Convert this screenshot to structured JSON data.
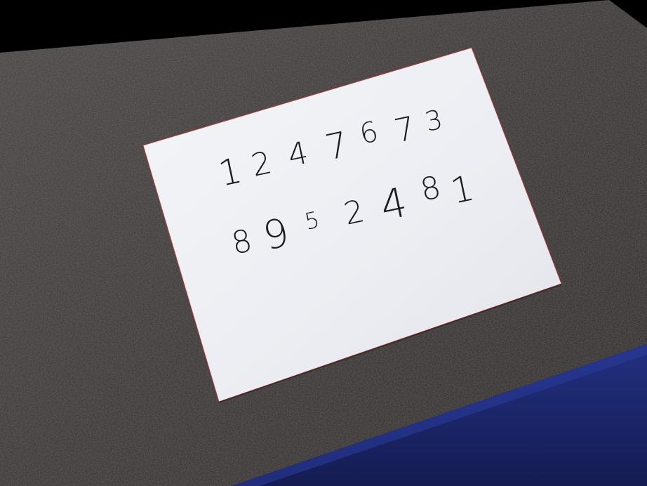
{
  "scene": {
    "description_colors": {
      "background": "#000000",
      "binder": "#3a3636",
      "binder_edge": "#1a2670",
      "paper": "#f1f2f6"
    },
    "note": {
      "row1": [
        "1",
        "2",
        "4",
        "7",
        "6",
        "7",
        "3"
      ],
      "row2": [
        "8",
        "9",
        "5",
        "2",
        "4",
        "8",
        "1"
      ]
    }
  }
}
